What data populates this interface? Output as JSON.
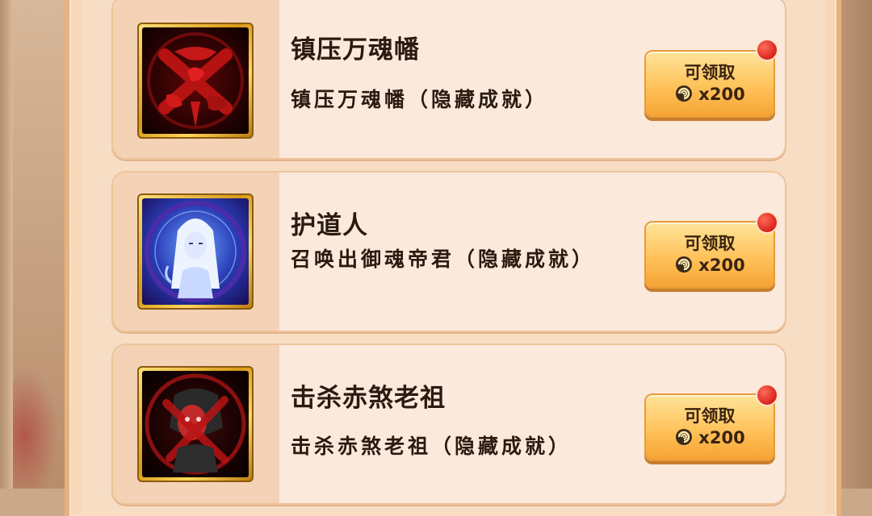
{
  "achievements": [
    {
      "title": "镇压万魂幡",
      "description": "镇压万魂幡（隐藏成就）",
      "claim_label": "可领取",
      "reward_text": "x200",
      "icon": "cursed-banner-icon",
      "has_notification": true
    },
    {
      "title": "护道人",
      "description": "召唤出御魂帝君（隐藏成就）",
      "claim_label": "可领取",
      "reward_text": "x200",
      "icon": "white-haired-immortal-portrait",
      "has_notification": true
    },
    {
      "title": "击杀赤煞老祖",
      "description": "击杀赤煞老祖（隐藏成就）",
      "claim_label": "可领取",
      "reward_text": "x200",
      "icon": "red-demon-portrait",
      "has_notification": true
    }
  ],
  "colors": {
    "panel": "#f6d7b8",
    "card": "#fbe9dc",
    "button": "#ffc25a",
    "notification": "#d8241c"
  }
}
